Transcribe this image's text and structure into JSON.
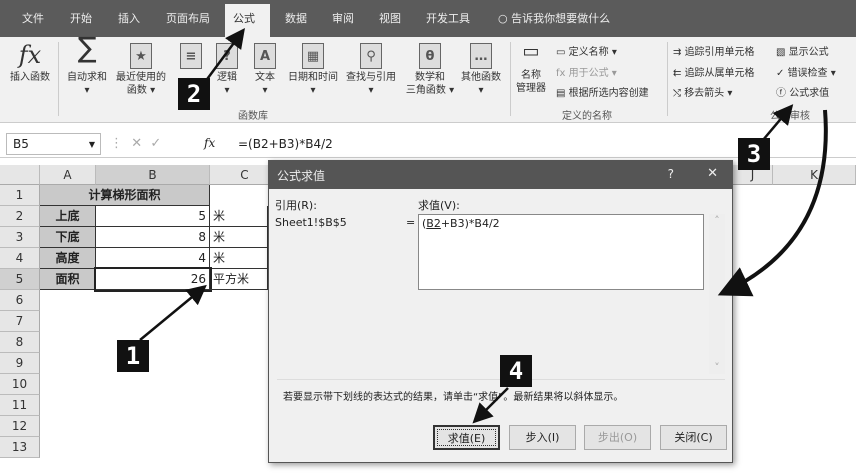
{
  "menu": {
    "tabs": [
      "文件",
      "开始",
      "插入",
      "页面布局",
      "公式",
      "数据",
      "审阅",
      "视图",
      "开发工具"
    ],
    "active": "公式",
    "tell_me": "告诉我你想要做什么"
  },
  "ribbon": {
    "function_library": {
      "label": "函数库",
      "insert_function": "插入函数",
      "autosum": "自动求和",
      "recent": "最近使用的",
      "recent2": "函数 ▾",
      "logical": "逻辑",
      "text": "文本",
      "datetime": "日期和时间",
      "lookup": "查找与引用",
      "math": "数学和",
      "math2": "三角函数 ▾",
      "more": "其他函数"
    },
    "defined_names": {
      "label": "定义的名称",
      "name_manager": "名称",
      "name_manager2": "管理器",
      "define_name": "定义名称 ▾",
      "use_in_formula": "用于公式 ▾",
      "create_from_selection": "根据所选内容创建"
    },
    "formula_auditing": {
      "label": "公式审核",
      "trace_precedents": "追踪引用单元格",
      "trace_dependents": "追踪从属单元格",
      "remove_arrows": "移去箭头 ▾",
      "show_formulas": "显示公式",
      "error_checking": "错误检查 ▾",
      "evaluate_formula": "公式求值"
    }
  },
  "formula_bar": {
    "name_box": "B5",
    "fx": "fx",
    "formula": "=(B2+B3)*B4/2"
  },
  "sheet": {
    "columns": [
      "A",
      "B",
      "C",
      "J",
      "K"
    ],
    "rows": [
      "1",
      "2",
      "3",
      "4",
      "5",
      "6",
      "7",
      "8",
      "9",
      "10",
      "11",
      "12",
      "13"
    ],
    "title": "计算梯形面积",
    "data": [
      [
        "上底",
        "5",
        "米"
      ],
      [
        "下底",
        "8",
        "米"
      ],
      [
        "高度",
        "4",
        "米"
      ],
      [
        "面积",
        "26",
        "平方米"
      ]
    ]
  },
  "dialog": {
    "title": "公式求值",
    "help": "?",
    "close": "✕",
    "reference_label": "引用(R):",
    "reference": "Sheet1!$B$5",
    "equals": "=",
    "evaluation_label": "求值(V):",
    "evaluation_underlined": "B2",
    "evaluation_pre": "(",
    "evaluation_post": "+B3)*B4/2",
    "hint": "若要显示带下划线的表达式的结果，请单击“求值”。最新结果将以斜体显示。",
    "buttons": {
      "evaluate": "求值(E)",
      "step_in": "步入(I)",
      "step_out": "步出(O)",
      "close": "关闭(C)"
    }
  },
  "callouts": [
    "1",
    "2",
    "3",
    "4"
  ]
}
